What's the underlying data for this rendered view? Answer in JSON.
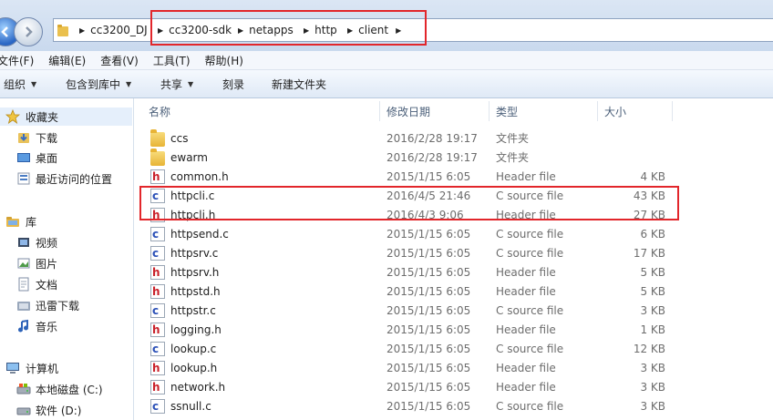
{
  "address": {
    "crumbs": [
      "cc3200_DJ",
      "cc3200-sdk",
      "netapps",
      "http",
      "client"
    ]
  },
  "menu": [
    "文件(F)",
    "编辑(E)",
    "查看(V)",
    "工具(T)",
    "帮助(H)"
  ],
  "toolbar": {
    "organize": "组织",
    "include_library": "包含到库中",
    "share": "共享",
    "burn": "刻录",
    "new_folder": "新建文件夹"
  },
  "sidebar": {
    "favorites": "收藏夹",
    "favorites_items": [
      "下载",
      "桌面",
      "最近访问的位置"
    ],
    "libraries": "库",
    "libraries_items": [
      "视频",
      "图片",
      "文档",
      "迅雷下载",
      "音乐"
    ],
    "computer": "计算机",
    "computer_items": [
      "本地磁盘 (C:)",
      "软件 (D:)"
    ]
  },
  "columns": {
    "name": "名称",
    "date": "修改日期",
    "type": "类型",
    "size": "大小"
  },
  "files": [
    {
      "name": "ccs",
      "date": "2016/2/28 19:17",
      "type": "文件夹",
      "size": "",
      "kind": "folder"
    },
    {
      "name": "ewarm",
      "date": "2016/2/28 19:17",
      "type": "文件夹",
      "size": "",
      "kind": "folder"
    },
    {
      "name": "common.h",
      "date": "2015/1/15 6:05",
      "type": "Header file",
      "size": "4 KB",
      "kind": "h"
    },
    {
      "name": "httpcli.c",
      "date": "2016/4/5 21:46",
      "type": "C source file",
      "size": "43 KB",
      "kind": "c"
    },
    {
      "name": "httpcli.h",
      "date": "2016/4/3 9:06",
      "type": "Header file",
      "size": "27 KB",
      "kind": "h"
    },
    {
      "name": "httpsend.c",
      "date": "2015/1/15 6:05",
      "type": "C source file",
      "size": "6 KB",
      "kind": "c"
    },
    {
      "name": "httpsrv.c",
      "date": "2015/1/15 6:05",
      "type": "C source file",
      "size": "17 KB",
      "kind": "c"
    },
    {
      "name": "httpsrv.h",
      "date": "2015/1/15 6:05",
      "type": "Header file",
      "size": "5 KB",
      "kind": "h"
    },
    {
      "name": "httpstd.h",
      "date": "2015/1/15 6:05",
      "type": "Header file",
      "size": "5 KB",
      "kind": "h"
    },
    {
      "name": "httpstr.c",
      "date": "2015/1/15 6:05",
      "type": "C source file",
      "size": "3 KB",
      "kind": "c"
    },
    {
      "name": "logging.h",
      "date": "2015/1/15 6:05",
      "type": "Header file",
      "size": "1 KB",
      "kind": "h"
    },
    {
      "name": "lookup.c",
      "date": "2015/1/15 6:05",
      "type": "C source file",
      "size": "12 KB",
      "kind": "c"
    },
    {
      "name": "lookup.h",
      "date": "2015/1/15 6:05",
      "type": "Header file",
      "size": "3 KB",
      "kind": "h"
    },
    {
      "name": "network.h",
      "date": "2015/1/15 6:05",
      "type": "Header file",
      "size": "3 KB",
      "kind": "h"
    },
    {
      "name": "ssnull.c",
      "date": "2015/1/15 6:05",
      "type": "C source file",
      "size": "3 KB",
      "kind": "c"
    }
  ],
  "colors": {
    "highlight": "#e2262b",
    "header_icon": "#c9202a",
    "source_icon": "#2a4fb7"
  }
}
